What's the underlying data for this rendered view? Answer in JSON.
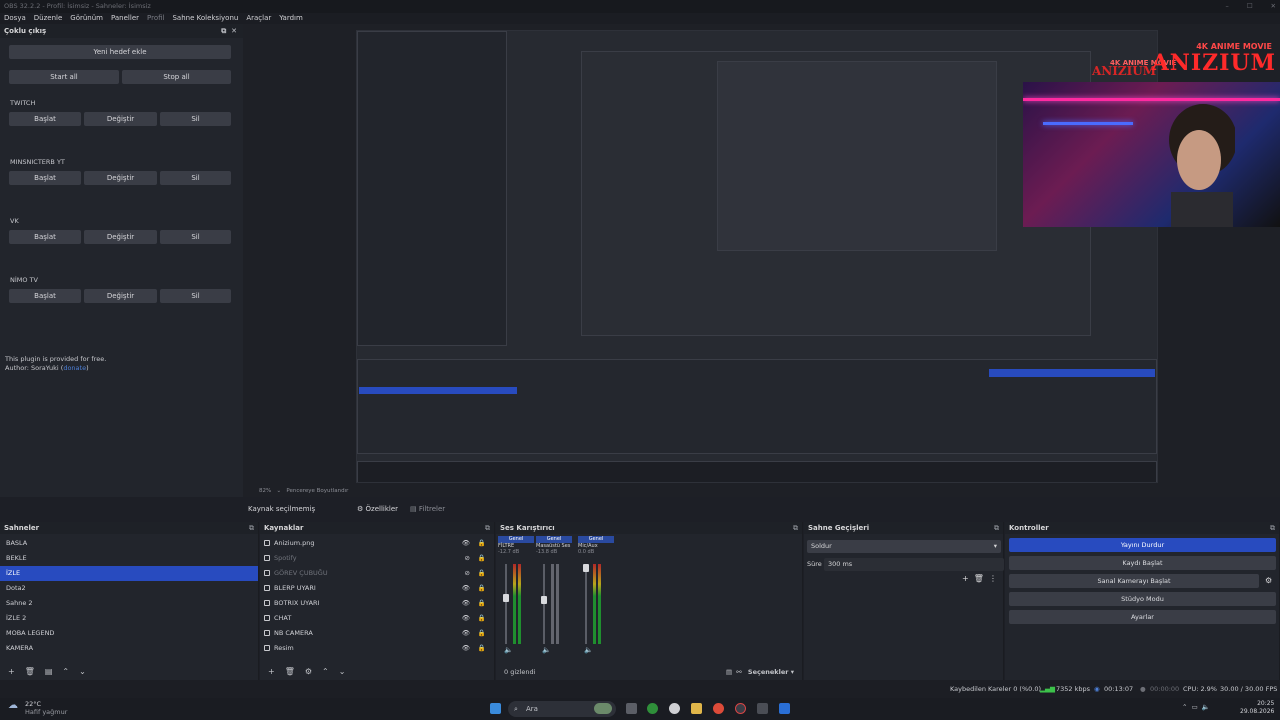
{
  "window": {
    "title": "OBS 32.2.2 - Profil: İsimsiz - Sahneler: İsimsiz"
  },
  "menu": {
    "items": [
      "Dosya",
      "Düzenle",
      "Görünüm",
      "Paneller",
      "Profil",
      "Sahne Koleksiyonu",
      "Araçlar",
      "Yardım"
    ]
  },
  "multistream": {
    "title": "Çoklu çıkış",
    "add_target": "Yeni hedef ekle",
    "start_all": "Start all",
    "stop_all": "Stop all",
    "targets": [
      {
        "name": "TWITCH",
        "start": "Başlat",
        "edit": "Değiştir",
        "delete": "Sil"
      },
      {
        "name": "MINSNICTERB YT",
        "start": "Başlat",
        "edit": "Değiştir",
        "delete": "Sil"
      },
      {
        "name": "VK",
        "start": "Başlat",
        "edit": "Değiştir",
        "delete": "Sil"
      },
      {
        "name": "NİMO TV",
        "start": "Başlat",
        "edit": "Değiştir",
        "delete": "Sil"
      }
    ],
    "plugin_note": "This plugin is provided for free.",
    "author_prefix": "Author: SoraYuki (",
    "author_link": "donate",
    "author_suffix": ")"
  },
  "overlay": {
    "brand_big": "ANIZIUM",
    "brand_tag": "4K ANIME MOVIE",
    "brand_small": "ANIZIUM"
  },
  "zoom": {
    "level": "82%",
    "mode": "Pencereye Boyutlandır"
  },
  "source_bar": {
    "status": "Kaynak seçilmemiş",
    "properties": "Özellikler",
    "filters": "Filtreler"
  },
  "scenes": {
    "title": "Sahneler",
    "items": [
      "BASLA",
      "BEKLE",
      "İZLE",
      "Dota2",
      "Sahne 2",
      "İZLE 2",
      "MOBA LEGEND",
      "KAMERA"
    ],
    "selected_index": 2
  },
  "sources": {
    "title": "Kaynaklar",
    "items": [
      {
        "name": "Anizium.png",
        "hidden": false
      },
      {
        "name": "Spotify",
        "hidden": true
      },
      {
        "name": "GÖREV ÇUBUĞU",
        "hidden": true
      },
      {
        "name": "BLERP UYARI",
        "hidden": false
      },
      {
        "name": "BOTRIX UYARI",
        "hidden": false
      },
      {
        "name": "CHAT",
        "hidden": false
      },
      {
        "name": "NB CAMERA",
        "hidden": false
      },
      {
        "name": "Resim",
        "hidden": false
      }
    ]
  },
  "mixer": {
    "title": "Ses Karıştırıcı",
    "channels": [
      {
        "tab": "Genel",
        "name": "FİLTRE",
        "db": "-12.7 dB"
      },
      {
        "tab": "Genel",
        "name": "Masaüstü Ses",
        "db": "-13.8 dB"
      },
      {
        "tab": "Genel",
        "name": "Mic/Aux",
        "db": "0.0 dB"
      }
    ],
    "hidden_count": "0 gizlendi",
    "options": "Seçenekler"
  },
  "transitions": {
    "title": "Sahne Geçişleri",
    "selected": "Soldur",
    "duration_label": "Süre",
    "duration_value": "300 ms"
  },
  "controls": {
    "title": "Kontroller",
    "buttons": [
      "Yayını Durdur",
      "Kaydı Başlat",
      "Sanal Kamerayı Başlat",
      "Stüdyo Modu",
      "Ayarlar"
    ]
  },
  "status": {
    "dropped": "Kaybedilen Kareler 0 (%0.0)",
    "bitrate": "7352 kbps",
    "stream_time": "00:13:07",
    "record_time": "00:00:00",
    "cpu": "CPU: 2.9%",
    "fps": "30.00 / 30.00 FPS"
  },
  "taskbar": {
    "weather_temp": "22°C",
    "weather_desc": "Hafif yağmur",
    "search": "Ara",
    "time": "20:25",
    "date": "29.08.2026"
  },
  "colors": {
    "accent": "#284bbf",
    "panel": "#22252c",
    "background": "#1d1f26"
  }
}
